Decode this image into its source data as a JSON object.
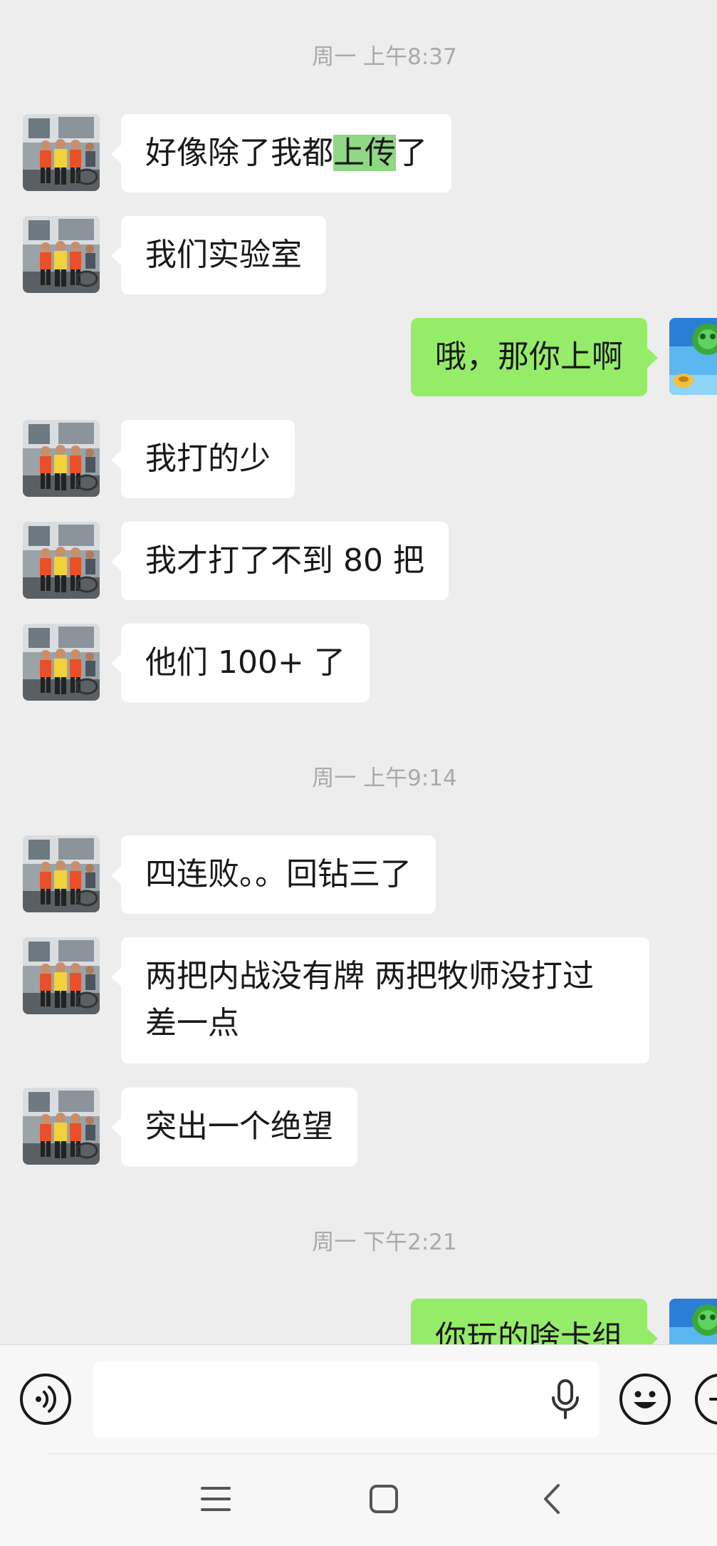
{
  "timestamps": [
    "周一 上午8:37",
    "周一 上午9:14",
    "周一 下午2:21"
  ],
  "messages": [
    {
      "side": "in",
      "parts": [
        "好像除了我都",
        "上传",
        "了"
      ]
    },
    {
      "side": "in",
      "text": "我们实验室"
    },
    {
      "side": "out",
      "text": "哦，那你上啊"
    },
    {
      "side": "in",
      "text": "我打的少"
    },
    {
      "side": "in",
      "text": "我才打了不到 80 把"
    },
    {
      "side": "in",
      "text": "他们 100+ 了"
    },
    {
      "side": "in",
      "text": "四连败。。回钻三了"
    },
    {
      "side": "in",
      "lines": [
        "两把内战没有牌 两把牧师没打过",
        "差一点"
      ]
    },
    {
      "side": "in",
      "text": "突出一个绝望"
    },
    {
      "side": "out",
      "text": "你玩的啥卡组"
    }
  ],
  "input": {
    "placeholder": ""
  },
  "icons": {
    "voice": "voice-wave-icon",
    "mic": "microphone-icon",
    "emoji": "smiley-face-icon",
    "more": "plus-circle-icon",
    "nav_menu": "menu-lines-icon",
    "nav_home": "home-square-icon",
    "nav_back": "back-chevron-icon"
  },
  "colors": {
    "background": "#ededed",
    "bubble_in": "#ffffff",
    "bubble_out": "#95ec69",
    "highlight": "#8fd884",
    "timestamp": "#a9a9a9"
  }
}
